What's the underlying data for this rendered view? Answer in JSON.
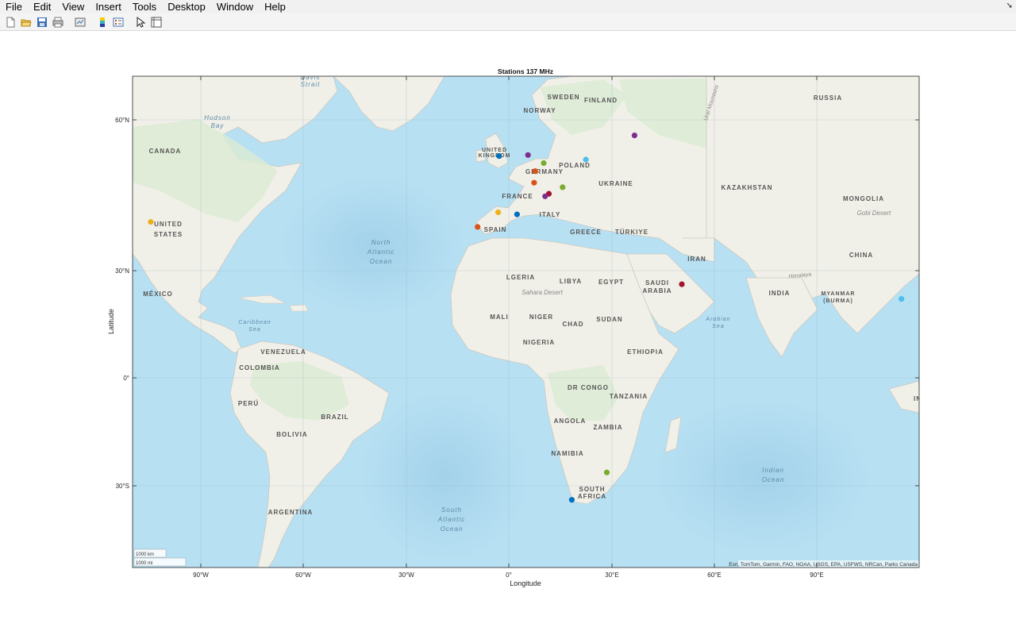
{
  "menubar": {
    "items": [
      "File",
      "Edit",
      "View",
      "Insert",
      "Tools",
      "Desktop",
      "Window",
      "Help"
    ],
    "collapse_icon": "dock-arrow-icon"
  },
  "toolbar": {
    "buttons": [
      {
        "name": "new-figure-button",
        "icon": "new-file-icon"
      },
      {
        "name": "open-file-button",
        "icon": "folder-open-icon"
      },
      {
        "name": "save-figure-button",
        "icon": "save-disk-icon"
      },
      {
        "name": "print-button",
        "icon": "printer-icon"
      },
      {
        "name": "link-plot-button",
        "icon": "link-plot-icon"
      },
      {
        "name": "colorbar-button",
        "icon": "colorbar-icon"
      },
      {
        "name": "legend-button",
        "icon": "legend-icon"
      },
      {
        "name": "edit-plot-button",
        "icon": "pointer-arrow-icon"
      },
      {
        "name": "property-inspector-button",
        "icon": "property-inspector-icon"
      }
    ]
  },
  "map": {
    "title": "Stations 137 MHz",
    "xlabel": "Longitude",
    "ylabel": "Latitude",
    "lon_range": [
      -110,
      120
    ],
    "lat_range": [
      -50,
      73
    ],
    "lon_ticks": [
      "90°W",
      "60°W",
      "30°W",
      "0°",
      "30°E",
      "60°E",
      "90°E"
    ],
    "lat_ticks": [
      "60°N",
      "30°N",
      "0°",
      "30°S"
    ],
    "attribution": "Esri, TomTom, Garmin, FAO, NOAA, USGS, EPA, USFWS, NRCan, Parks Canada",
    "scalebar": [
      "1000 km",
      "1000 mi"
    ],
    "colors": {
      "ocean": "#b8e0f3",
      "deep_ocean": "#a6d4ec",
      "land": "#f2f1ea",
      "forest": "#dcebd2",
      "border": "#b4b4b4"
    },
    "labels": {
      "countries": [
        "CANADA",
        "UNITED STATES",
        "MÉXICO",
        "VENEZUELA",
        "COLOMBIA",
        "PERÚ",
        "BRAZIL",
        "BOLIVIA",
        "ARGENTINA",
        "UNITED KINGDOM",
        "SWEDEN",
        "NORWAY",
        "FINLAND",
        "POLAND",
        "GERMANY",
        "FRANCE",
        "SPAIN",
        "ITALY",
        "UKRAINE",
        "GREECE",
        "TÜRKIYE",
        "RUSSIA",
        "KAZAKHSTAN",
        "MONGOLIA",
        "CHINA",
        "IRAN",
        "SAUDI ARABIA",
        "EGYPT",
        "LIBYA",
        "ALGERIA",
        "MALI",
        "NIGER",
        "CHAD",
        "SUDAN",
        "NIGERIA",
        "ETHIOPIA",
        "DR CONGO",
        "TANZANIA",
        "ANGOLA",
        "ZAMBIA",
        "NAMIBIA",
        "SOUTH AFRICA",
        "INDIA",
        "MYANMAR (BURMA)",
        "INDO"
      ],
      "seas": [
        "Hudson Bay",
        "Davis Strait",
        "North Atlantic Ocean",
        "Caribbean Sea",
        "South Atlantic Ocean",
        "Arabian Sea",
        "Indian Ocean"
      ],
      "regions": [
        "Sahara Desert",
        "Gobi Desert",
        "Himalaya",
        "Ural Mountains"
      ]
    }
  },
  "chart_data": {
    "type": "scatter",
    "title": "Stations 137 MHz",
    "xlabel": "Longitude",
    "ylabel": "Latitude",
    "xlim": [
      -110,
      120
    ],
    "ylim": [
      -50,
      73
    ],
    "grid": true,
    "points": [
      {
        "lon": -104.5,
        "lat": 39.7,
        "color": "#EDB120"
      },
      {
        "lon": -9.1,
        "lat": 38.7,
        "color": "#D95319"
      },
      {
        "lon": -3.1,
        "lat": 41.6,
        "color": "#EDB120"
      },
      {
        "lon": 2.4,
        "lat": 41.2,
        "color": "#0072BD"
      },
      {
        "lon": -2.8,
        "lat": 52.8,
        "color": "#0072BD"
      },
      {
        "lon": 5.6,
        "lat": 53.0,
        "color": "#7E2F8E"
      },
      {
        "lon": 10.2,
        "lat": 51.4,
        "color": "#77AC30"
      },
      {
        "lon": 7.7,
        "lat": 49.8,
        "color": "#D95319"
      },
      {
        "lon": 7.4,
        "lat": 47.5,
        "color": "#D95319"
      },
      {
        "lon": 15.7,
        "lat": 46.6,
        "color": "#77AC30"
      },
      {
        "lon": 11.7,
        "lat": 45.3,
        "color": "#A2142F"
      },
      {
        "lon": 10.6,
        "lat": 44.8,
        "color": "#7E2F8E"
      },
      {
        "lon": 22.5,
        "lat": 52.1,
        "color": "#4DBEEE"
      },
      {
        "lon": 36.7,
        "lat": 56.9,
        "color": "#7E2F8E"
      },
      {
        "lon": 50.5,
        "lat": 26.2,
        "color": "#A2142F"
      },
      {
        "lon": 114.6,
        "lat": 22.1,
        "color": "#4DBEEE"
      },
      {
        "lon": 28.6,
        "lat": -26.3,
        "color": "#77AC30"
      },
      {
        "lon": 18.4,
        "lat": -33.9,
        "color": "#0072BD"
      }
    ]
  }
}
